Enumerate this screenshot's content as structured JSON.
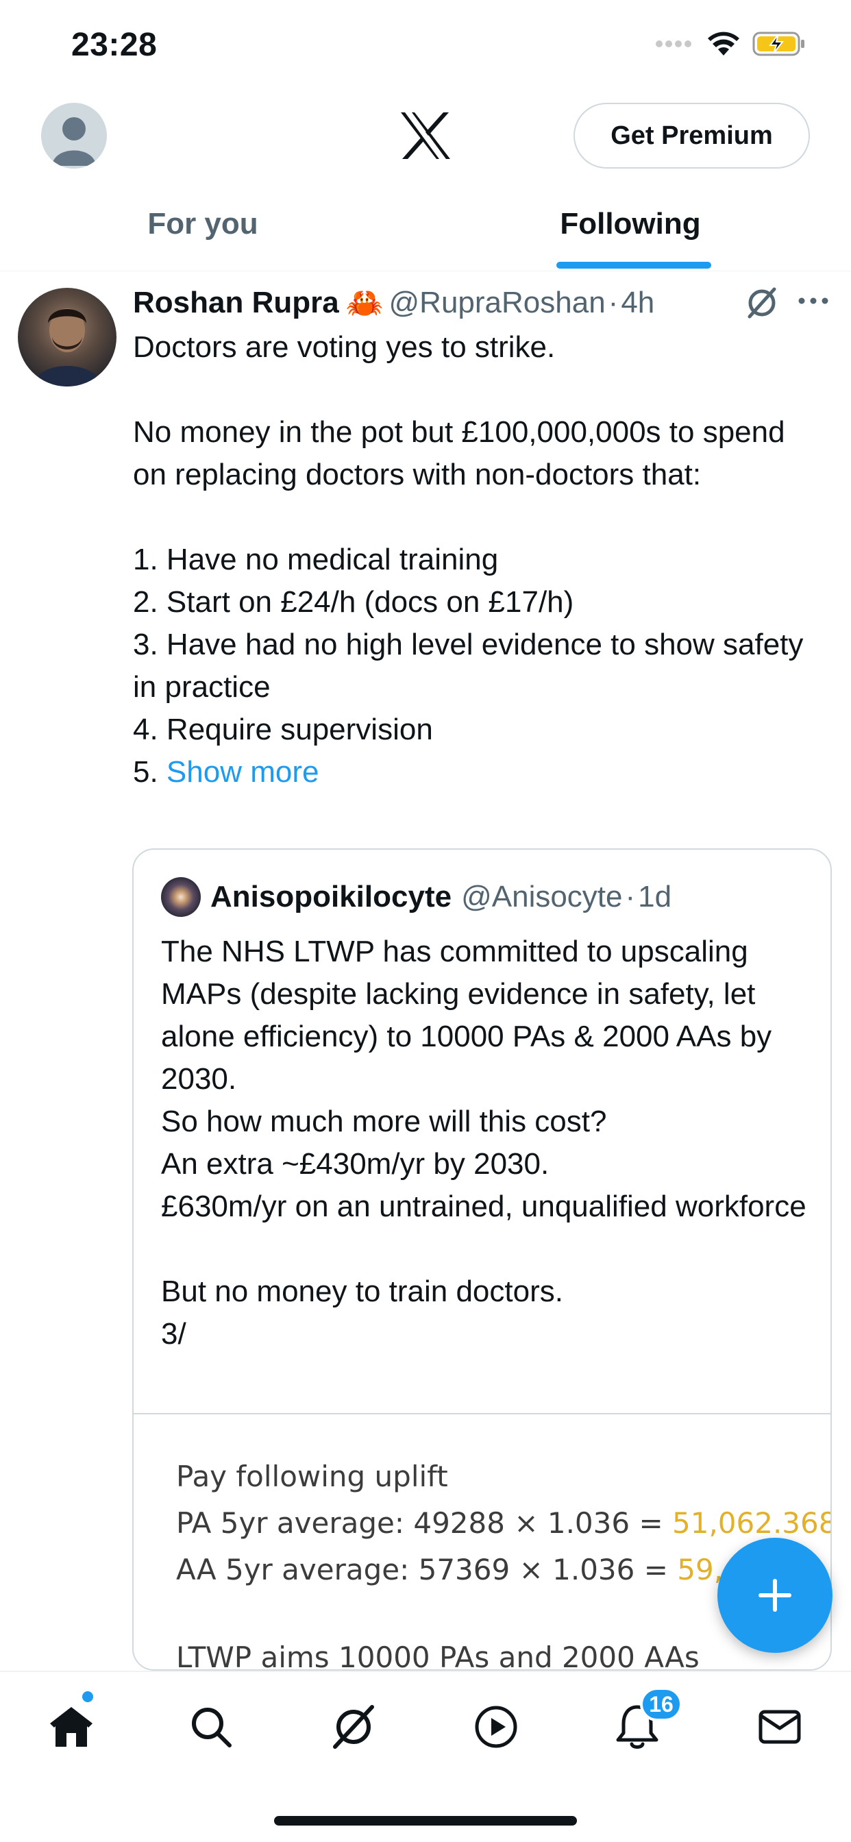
{
  "status_bar": {
    "time": "23:28"
  },
  "header": {
    "premium_label": "Get Premium",
    "tabs": [
      {
        "label": "For you",
        "active": false
      },
      {
        "label": "Following",
        "active": true
      }
    ],
    "accent_color": "#1d9bf0"
  },
  "tweet": {
    "author_name": "Roshan Rupra",
    "author_emoji": "🦀",
    "handle": "@RupraRoshan",
    "separator": "·",
    "time": "4h",
    "body": "Doctors are voting yes to strike.\n\nNo money in the pot but £100,000,000s to spend on replacing doctors with non-doctors that:\n\n1. Have no medical training\n2. Start on £24/h (docs on £17/h)\n3. Have had no high level evidence to show safety in practice\n4. Require supervision\n5. ",
    "show_more": "Show more",
    "quote": {
      "author_name": "Anisopoikilocyte",
      "handle": "@Anisocyte",
      "separator": "·",
      "time": "1d",
      "body": "The NHS LTWP has committed to upscaling MAPs (despite lacking evidence in safety, let alone efficiency) to 10000 PAs & 2000 AAs by 2030.\nSo how much more will this cost?\nAn extra ~£430m/yr by 2030.\n£630m/yr on an untrained, unqualified workforce\n\nBut no money to train doctors.\n3/",
      "image_text": {
        "line1": "Pay following uplift",
        "line2_prefix": "PA 5yr average: 49288 × 1.036 = ",
        "line2_value": "51,062.368",
        "line3_prefix": "AA 5yr average: 57369 × 1.036 = ",
        "line3_value": "59,43",
        "line4": "LTWP aims 10000 PAs and 2000 AAs"
      }
    }
  },
  "bottom_nav": {
    "items": [
      "home-icon",
      "search-icon",
      "grok-icon",
      "video-icon",
      "notifications-icon",
      "messages-icon"
    ],
    "notifications_count": "16"
  }
}
